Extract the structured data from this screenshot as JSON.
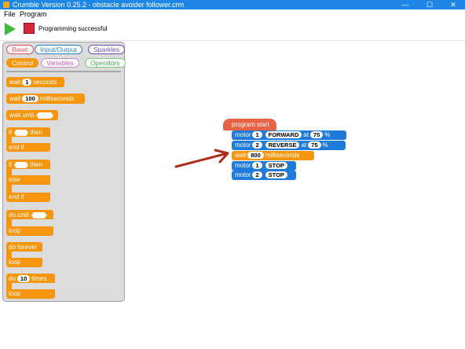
{
  "window": {
    "title": "Crumble Version 0.25.2 - obstacle avoider follower.crm",
    "minimize": "—",
    "maximize": "☐",
    "close": "✕"
  },
  "menu": {
    "file": "File",
    "program": "Program"
  },
  "toolbar": {
    "status": "Programming successful"
  },
  "palette": {
    "categories": [
      "Basic",
      "Input/Output",
      "Sparkles",
      "Control",
      "Variables",
      "Operators"
    ],
    "active_category": "Control",
    "blocks": {
      "wait_seconds": {
        "label": "wait",
        "value": "1",
        "unit": "seconds"
      },
      "wait_ms": {
        "label": "wait",
        "value": "100",
        "unit": "milliseconds"
      },
      "wait_until": "wait until",
      "if1": {
        "if": "if",
        "then": "then",
        "end": "end if"
      },
      "if2": {
        "if": "if",
        "then": "then",
        "else": "else",
        "end": "end if"
      },
      "do_until": {
        "label": "do until",
        "loop": "loop"
      },
      "do_forever": {
        "label": "do forever",
        "loop": "loop"
      },
      "do_times": {
        "label": "do",
        "value": "10",
        "unit": "times",
        "loop": "loop"
      }
    }
  },
  "program": {
    "start": "program start",
    "lines": [
      {
        "kind": "motor",
        "label": "motor",
        "num": "1",
        "dir": "FORWARD",
        "at": "at",
        "speed": "75",
        "unit": "%"
      },
      {
        "kind": "motor",
        "label": "motor",
        "num": "2",
        "dir": "REVERSE",
        "at": "at",
        "speed": "75",
        "unit": "%"
      },
      {
        "kind": "wait",
        "label": "wait",
        "value": "800",
        "unit": "milliseconds"
      },
      {
        "kind": "motor",
        "label": "motor",
        "num": "1",
        "dir": "STOP"
      },
      {
        "kind": "motor",
        "label": "motor",
        "num": "2",
        "dir": "STOP"
      }
    ]
  },
  "colors": {
    "titlebar": "#1e87e6",
    "control_block": "#f6960f",
    "motor_block": "#1f7bd9",
    "start_block": "#e76346",
    "arrow": "#b02a1a"
  }
}
